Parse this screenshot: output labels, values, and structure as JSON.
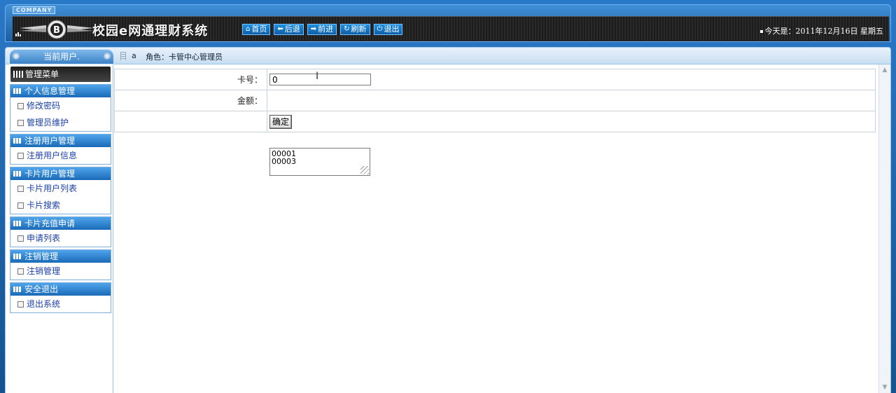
{
  "header": {
    "company": "COMPANY",
    "title": "校园e网通理财系统",
    "nav": [
      {
        "icon": "home-icon",
        "glyph": "⌂",
        "label": "首页"
      },
      {
        "icon": "arrow-left-icon",
        "glyph": "⬅",
        "label": "后退"
      },
      {
        "icon": "arrow-right-icon",
        "glyph": "➡",
        "label": "前进"
      },
      {
        "icon": "refresh-icon",
        "glyph": "↻",
        "label": "刷新"
      },
      {
        "icon": "power-icon",
        "glyph": "⏻",
        "label": "退出"
      }
    ],
    "date": "今天是：2011年12月16日 星期五"
  },
  "subbar": {
    "current_user_label": "当前用户.",
    "username": "a",
    "role": "角色：卡管中心管理员"
  },
  "sidebar": {
    "menu_title": "管理菜单",
    "groups": [
      {
        "title": "个人信息管理",
        "items": [
          "修改密码",
          "管理员维护"
        ]
      },
      {
        "title": "注册用户管理",
        "items": [
          "注册用户信息"
        ]
      },
      {
        "title": "卡片用户管理",
        "items": [
          "卡片用户列表",
          "卡片搜索"
        ]
      },
      {
        "title": "卡片充值申请",
        "items": [
          "申请列表"
        ]
      },
      {
        "title": "注销管理",
        "items": [
          "注销管理"
        ]
      },
      {
        "title": "安全退出",
        "items": [
          "退出系统"
        ]
      }
    ]
  },
  "form": {
    "card_label": "卡号：",
    "card_value": "0",
    "amount_label": "金额：",
    "suggestions": [
      "00001",
      "00003"
    ],
    "confirm_label": "确定"
  }
}
